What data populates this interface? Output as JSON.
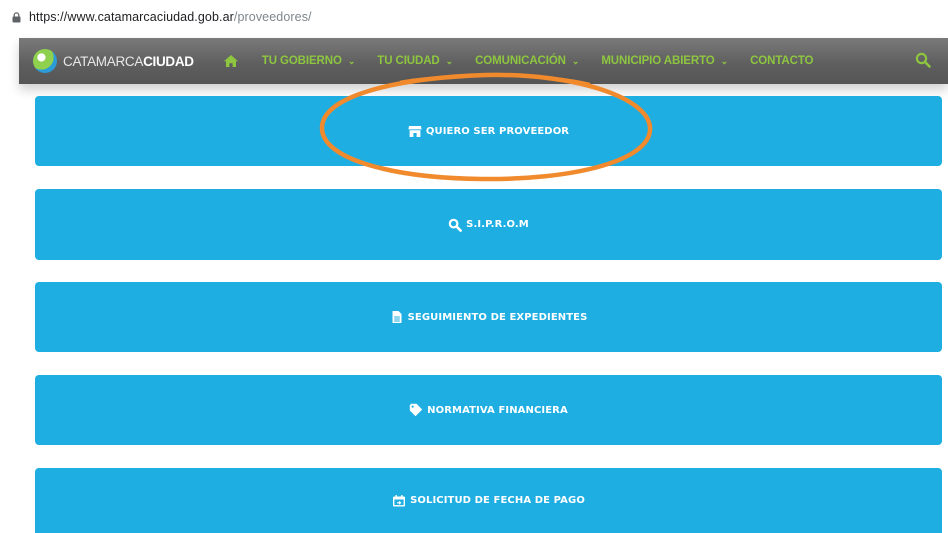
{
  "browser": {
    "url_host": "https://www.catamarcaciudad.gob.ar",
    "url_path": "/proveedores/"
  },
  "navbar": {
    "logo_light": "CATAMARCA",
    "logo_bold": "CIUDAD",
    "items": [
      {
        "label": "TU GOBIERNO",
        "dropdown": "⌄"
      },
      {
        "label": "TU CIUDAD",
        "dropdown": "⌄"
      },
      {
        "label": "COMUNICACIÓN",
        "dropdown": "⌄"
      },
      {
        "label": "MUNICIPIO ABIERTO",
        "dropdown": "⌄"
      },
      {
        "label": "CONTACTO",
        "dropdown": ""
      }
    ],
    "accent_color": "#8ec63f"
  },
  "actions": [
    {
      "label": "QUIERO SER PROVEEDOR",
      "icon": "store-icon"
    },
    {
      "label": "S.I.P.R.O.M",
      "icon": "search-icon"
    },
    {
      "label": "SEGUIMIENTO DE EXPEDIENTES",
      "icon": "document-icon"
    },
    {
      "label": "NORMATIVA FINANCIERA",
      "icon": "tag-icon"
    },
    {
      "label": "SOLICITUD DE FECHA DE PAGO",
      "icon": "calendar-icon"
    }
  ],
  "colors": {
    "button_bg": "#1eaee2",
    "highlight": "#f08a2c"
  }
}
